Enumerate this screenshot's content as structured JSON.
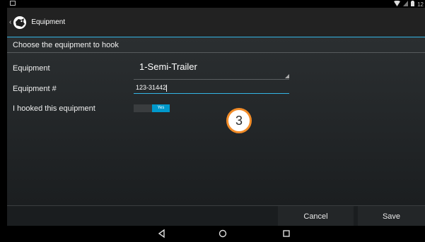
{
  "status_bar": {
    "time": "12",
    "icons": [
      "notification-icon",
      "wifi-icon",
      "signal-icon",
      "battery-icon"
    ]
  },
  "action_bar": {
    "title": "Equipment",
    "icons": [
      "up-chevron-icon",
      "app-logo-icon"
    ]
  },
  "form": {
    "section_header": "Choose the equipment to hook",
    "equipment_label": "Equipment",
    "equipment_value": "1-Semi-Trailer",
    "equipment_number_label": "Equipment #",
    "equipment_number_value": "123-31442",
    "hooked_label": "I hooked this equipment",
    "hooked_toggle_text": "Yes",
    "hooked_toggle_on": true
  },
  "step_badge": "3",
  "buttons": {
    "cancel": "Cancel",
    "save": "Save"
  },
  "colors": {
    "accent": "#33b5e5",
    "toggle_on": "#0099cc",
    "badge_ring": "#f28c28"
  },
  "nav_bar": {
    "icons": [
      "back-icon",
      "home-icon",
      "recents-icon"
    ]
  }
}
